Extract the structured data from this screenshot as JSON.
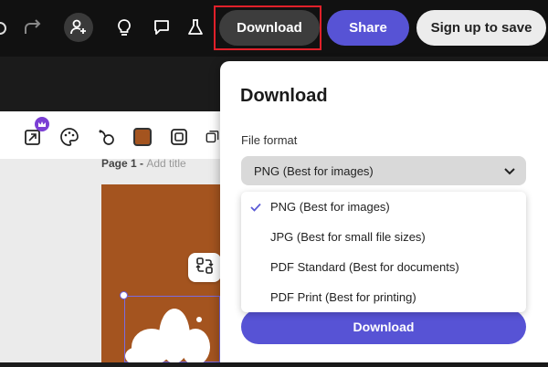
{
  "topbar": {
    "download_label": "Download",
    "share_label": "Share",
    "signup_label": "Sign up to save"
  },
  "canvas": {
    "page_prefix": "Page 1 - ",
    "page_title_placeholder": "Add title"
  },
  "download_panel": {
    "title": "Download",
    "file_format_label": "File format",
    "selected_format": "PNG (Best for images)",
    "options": [
      {
        "label": "PNG (Best for images)",
        "selected": true
      },
      {
        "label": "JPG (Best for small file sizes)",
        "selected": false
      },
      {
        "label": "PDF Standard (Best for documents)",
        "selected": false
      },
      {
        "label": "PDF Print (Best for printing)",
        "selected": false
      }
    ],
    "download_button_label": "Download"
  },
  "colors": {
    "accent": "#5753d5",
    "highlight_border": "#e0202a",
    "artboard": "#a4541f"
  },
  "icons": [
    "undo-icon",
    "redo-icon",
    "add-user-icon",
    "lightbulb-icon",
    "comment-icon",
    "flask-icon",
    "chevron-down-icon",
    "check-icon",
    "swap-icon"
  ]
}
